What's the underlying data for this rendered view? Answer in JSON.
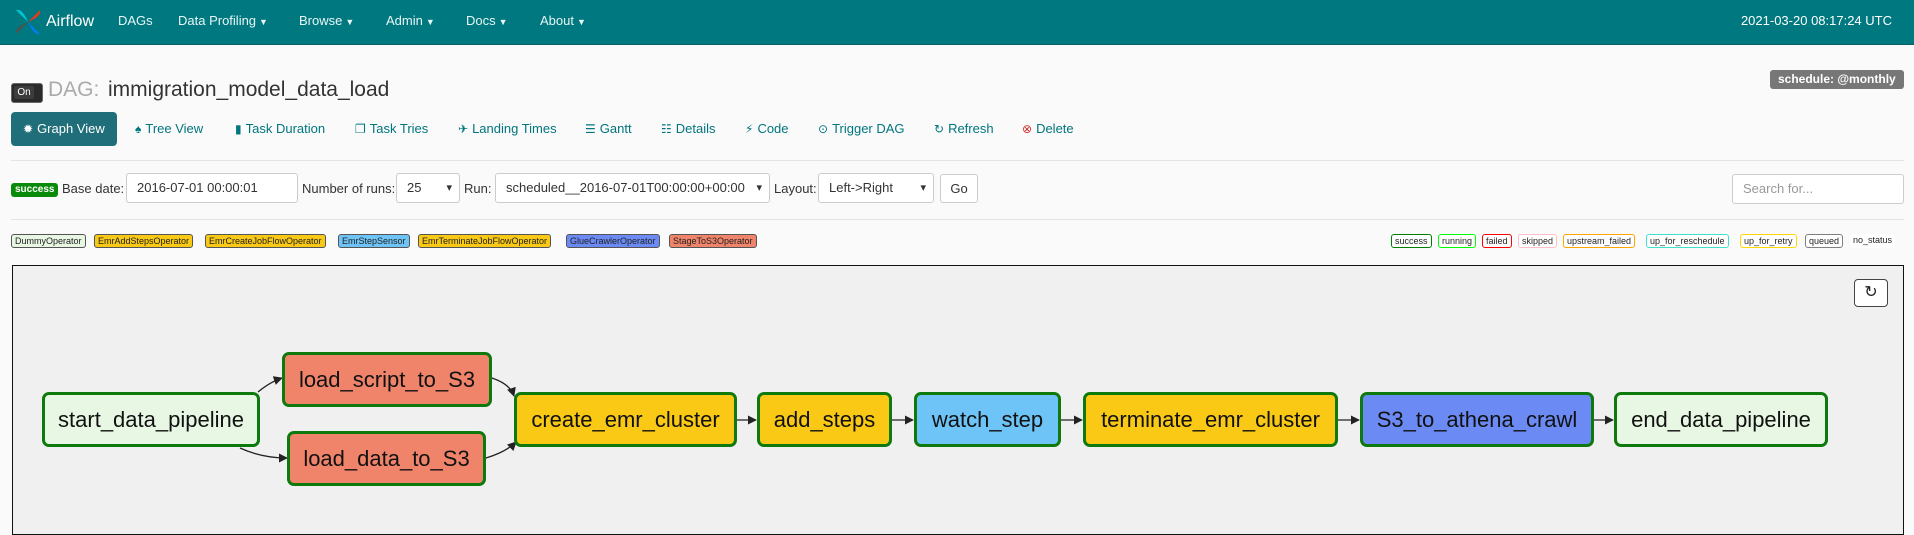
{
  "navbar": {
    "brand": "Airflow",
    "items": [
      {
        "label": "DAGs",
        "dropdown": false
      },
      {
        "label": "Data Profiling",
        "dropdown": true
      },
      {
        "label": "Browse",
        "dropdown": true
      },
      {
        "label": "Admin",
        "dropdown": true
      },
      {
        "label": "Docs",
        "dropdown": true
      },
      {
        "label": "About",
        "dropdown": true
      }
    ],
    "time": "2021-03-20 08:17:24 UTC"
  },
  "header": {
    "toggle_label": "On",
    "dag_prefix": "DAG:",
    "dag_id": "immigration_model_data_load",
    "schedule": "schedule: @monthly"
  },
  "tabs": [
    {
      "label": "Graph View",
      "icon": "asterisk-icon",
      "active": true
    },
    {
      "label": "Tree View",
      "icon": "tree-icon"
    },
    {
      "label": "Task Duration",
      "icon": "bar-chart-icon"
    },
    {
      "label": "Task Tries",
      "icon": "duplicate-icon"
    },
    {
      "label": "Landing Times",
      "icon": "plane-icon"
    },
    {
      "label": "Gantt",
      "icon": "gantt-icon"
    },
    {
      "label": "Details",
      "icon": "list-icon"
    },
    {
      "label": "Code",
      "icon": "flash-icon"
    },
    {
      "label": "Trigger DAG",
      "icon": "play-circle-icon"
    },
    {
      "label": "Refresh",
      "icon": "refresh-icon"
    },
    {
      "label": "Delete",
      "icon": "remove-circle-icon"
    }
  ],
  "form": {
    "status_badge": "success",
    "base_date_label": "Base date:",
    "base_date_value": "2016-07-01 00:00:01",
    "num_runs_label": "Number of runs:",
    "num_runs_value": "25",
    "run_label": "Run:",
    "run_value": "scheduled__2016-07-01T00:00:00+00:00",
    "layout_label": "Layout:",
    "layout_value": "Left->Right",
    "go_label": "Go",
    "search_placeholder": "Search for..."
  },
  "operator_legend": [
    {
      "label": "DummyOperator",
      "color": "#e8f7e4"
    },
    {
      "label": "EmrAddStepsOperator",
      "color": "#f9c915"
    },
    {
      "label": "EmrCreateJobFlowOperator",
      "color": "#f9c915"
    },
    {
      "label": "EmrStepSensor",
      "color": "#6ec4f6"
    },
    {
      "label": "EmrTerminateJobFlowOperator",
      "color": "#f9c915"
    },
    {
      "label": "GlueCrawlerOperator",
      "color": "#6b8af3"
    },
    {
      "label": "StageToS3Operator",
      "color": "#f0846a"
    }
  ],
  "state_legend": [
    {
      "label": "success",
      "border": "#008000"
    },
    {
      "label": "running",
      "border": "#00ff00"
    },
    {
      "label": "failed",
      "border": "#ff0000"
    },
    {
      "label": "skipped",
      "border": "#ffc0cb"
    },
    {
      "label": "upstream_failed",
      "border": "#ffa500"
    },
    {
      "label": "up_for_reschedule",
      "border": "#40e0d0"
    },
    {
      "label": "up_for_retry",
      "border": "#ffd700"
    },
    {
      "label": "queued",
      "border": "#808080"
    },
    {
      "label": "no_status",
      "border": "none"
    }
  ],
  "graph": {
    "nodes": [
      {
        "id": "start_data_pipeline",
        "color": "#e8f7e4"
      },
      {
        "id": "load_script_to_S3",
        "color": "#f0846a"
      },
      {
        "id": "load_data_to_S3",
        "color": "#f0846a"
      },
      {
        "id": "create_emr_cluster",
        "color": "#f9c915"
      },
      {
        "id": "add_steps",
        "color": "#f9c915"
      },
      {
        "id": "watch_step",
        "color": "#6ec4f6"
      },
      {
        "id": "terminate_emr_cluster",
        "color": "#f9c915"
      },
      {
        "id": "S3_to_athena_crawl",
        "color": "#6b8af3"
      },
      {
        "id": "end_data_pipeline",
        "color": "#e8f7e4"
      }
    ],
    "edges": [
      [
        "start_data_pipeline",
        "load_script_to_S3"
      ],
      [
        "start_data_pipeline",
        "load_data_to_S3"
      ],
      [
        "load_script_to_S3",
        "create_emr_cluster"
      ],
      [
        "load_data_to_S3",
        "create_emr_cluster"
      ],
      [
        "create_emr_cluster",
        "add_steps"
      ],
      [
        "add_steps",
        "watch_step"
      ],
      [
        "watch_step",
        "terminate_emr_cluster"
      ],
      [
        "terminate_emr_cluster",
        "S3_to_athena_crawl"
      ],
      [
        "S3_to_athena_crawl",
        "end_data_pipeline"
      ]
    ]
  }
}
